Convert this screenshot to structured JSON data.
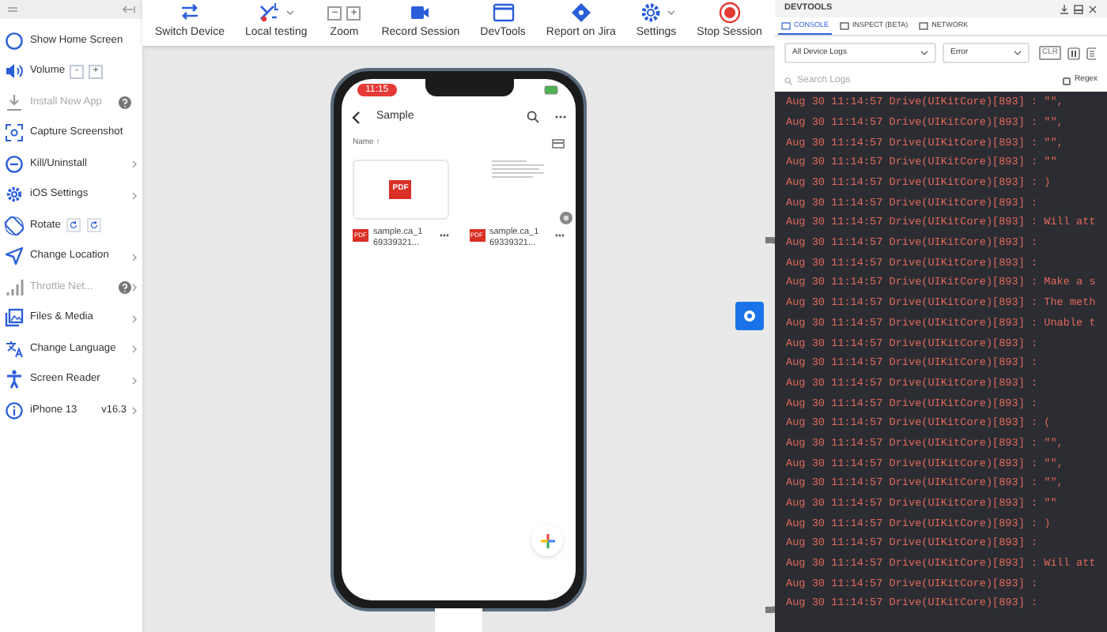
{
  "sidebar": {
    "items": [
      {
        "label": "Show Home Screen",
        "disabled": false,
        "help": false,
        "chevron": false
      },
      {
        "label": "Volume",
        "disabled": false,
        "help": false,
        "chevron": false,
        "buttons": [
          "-",
          "+"
        ]
      },
      {
        "label": "Install New App",
        "disabled": true,
        "help": true,
        "chevron": false
      },
      {
        "label": "Capture Screenshot",
        "disabled": false,
        "help": false,
        "chevron": false
      },
      {
        "label": "Kill/Uninstall",
        "disabled": false,
        "help": false,
        "chevron": true
      },
      {
        "label": "iOS Settings",
        "disabled": false,
        "help": false,
        "chevron": true
      },
      {
        "label": "Rotate",
        "disabled": false,
        "help": false,
        "chevron": false,
        "rotate_buttons": true
      },
      {
        "label": "Change Location",
        "disabled": false,
        "help": false,
        "chevron": true
      },
      {
        "label": "Throttle Net...",
        "disabled": true,
        "help": true,
        "chevron": true
      },
      {
        "label": "Files & Media",
        "disabled": false,
        "help": false,
        "chevron": true
      },
      {
        "label": "Change Language",
        "disabled": false,
        "help": false,
        "chevron": true
      },
      {
        "label": "Screen Reader",
        "disabled": false,
        "help": false,
        "chevron": true
      },
      {
        "label": "iPhone 13",
        "disabled": false,
        "help": false,
        "chevron": true,
        "version": "v16.3"
      }
    ]
  },
  "toolbar": [
    {
      "kind": "switch",
      "label": "Switch Device",
      "caret": false
    },
    {
      "kind": "local",
      "label": "Local testing",
      "caret": true
    },
    {
      "kind": "zoom",
      "label": "Zoom",
      "caret": false,
      "buttons": [
        "−",
        "+"
      ]
    },
    {
      "kind": "record",
      "label": "Record Session",
      "caret": false
    },
    {
      "kind": "devtools",
      "label": "DevTools",
      "caret": false
    },
    {
      "kind": "jira",
      "label": "Report on Jira",
      "caret": false
    },
    {
      "kind": "settings",
      "label": "Settings",
      "caret": true
    },
    {
      "kind": "stop",
      "label": "Stop Session",
      "caret": false
    }
  ],
  "phone": {
    "time": "11:15",
    "app_title": "Sample",
    "sort_label": "Name ↑",
    "files": [
      {
        "kind": "pdf",
        "badge": "PDF",
        "thumb_badge": "PDF",
        "name_lines": [
          "sample.ca_1",
          "69339321..."
        ]
      },
      {
        "kind": "document",
        "badge": "PDF",
        "name_lines": [
          "sample.ca_1",
          "69339321..."
        ]
      }
    ]
  },
  "devtools": {
    "title": "DEVTOOLS",
    "tabs": [
      {
        "label": "CONSOLE",
        "selected": true
      },
      {
        "label": "INSPECT (BETA)",
        "selected": false
      },
      {
        "label": "NETWORK",
        "selected": false
      }
    ],
    "source_select": "All Device Logs",
    "level_select": "Error",
    "clear_button": "CLR",
    "search": {
      "placeholder": "Search Logs"
    },
    "regex": {
      "label": "Regex",
      "checked": false
    },
    "logs": [
      {
        "prefix": "Aug 30 11:14:57 Drive(UIKitCore)[893] :",
        "message": "\"\","
      },
      {
        "prefix": "Aug 30 11:14:57 Drive(UIKitCore)[893] :",
        "message": "\"\","
      },
      {
        "prefix": "Aug 30 11:14:57 Drive(UIKitCore)[893] :",
        "message": "\"\","
      },
      {
        "prefix": "Aug 30 11:14:57 Drive(UIKitCore)[893] :",
        "message": "\"\""
      },
      {
        "prefix": "Aug 30 11:14:57 Drive(UIKitCore)[893] :",
        "message": ")"
      },
      {
        "prefix": "Aug 30 11:14:57 Drive(UIKitCore)[893] :"
      },
      {
        "prefix": "Aug 30 11:14:57 Drive(UIKitCore)[893] :",
        "message": "Will att"
      },
      {
        "prefix": "Aug 30 11:14:57 Drive(UIKitCore)[893] :"
      },
      {
        "prefix": "Aug 30 11:14:57 Drive(UIKitCore)[893] :"
      },
      {
        "prefix": "Aug 30 11:14:57 Drive(UIKitCore)[893] :",
        "message": "Make a s"
      },
      {
        "prefix": "Aug 30 11:14:57 Drive(UIKitCore)[893] :",
        "message": "The meth"
      },
      {
        "prefix": "Aug 30 11:14:57 Drive(UIKitCore)[893] :",
        "message": "Unable t"
      },
      {
        "prefix": "Aug 30 11:14:57 Drive(UIKitCore)[893] :"
      },
      {
        "prefix": "Aug 30 11:14:57 Drive(UIKitCore)[893] :"
      },
      {
        "prefix": "Aug 30 11:14:57 Drive(UIKitCore)[893] :"
      },
      {
        "prefix": "Aug 30 11:14:57 Drive(UIKitCore)[893] :"
      },
      {
        "prefix": "Aug 30 11:14:57 Drive(UIKitCore)[893] :",
        "message": "("
      },
      {
        "prefix": "Aug 30 11:14:57 Drive(UIKitCore)[893] :",
        "message": "\"\","
      },
      {
        "prefix": "Aug 30 11:14:57 Drive(UIKitCore)[893] :",
        "message": "\"\","
      },
      {
        "prefix": "Aug 30 11:14:57 Drive(UIKitCore)[893] :",
        "message": "\"\","
      },
      {
        "prefix": "Aug 30 11:14:57 Drive(UIKitCore)[893] :",
        "message": "\"\""
      },
      {
        "prefix": "Aug 30 11:14:57 Drive(UIKitCore)[893] :",
        "message": ")"
      },
      {
        "prefix": "Aug 30 11:14:57 Drive(UIKitCore)[893] :"
      },
      {
        "prefix": "Aug 30 11:14:57 Drive(UIKitCore)[893] :",
        "message": "Will att"
      },
      {
        "prefix": "Aug 30 11:14:57 Drive(UIKitCore)[893] :"
      },
      {
        "prefix": "Aug 30 11:14:57 Drive(UIKitCore)[893] :"
      }
    ]
  }
}
